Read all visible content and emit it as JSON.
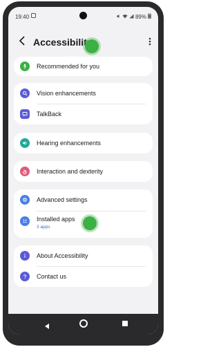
{
  "status": {
    "time": "19:40",
    "battery": "89%"
  },
  "header": {
    "title": "Accessibility"
  },
  "items": {
    "recommended": {
      "label": "Recommended for you"
    },
    "vision": {
      "label": "Vision enhancements"
    },
    "talkback": {
      "label": "TalkBack"
    },
    "hearing": {
      "label": "Hearing enhancements"
    },
    "interaction": {
      "label": "Interaction and dexterity"
    },
    "advanced": {
      "label": "Advanced settings"
    },
    "installed": {
      "label": "Installed apps",
      "sub": "3 apps"
    },
    "about": {
      "label": "About Accessibility"
    },
    "contact": {
      "label": "Contact us"
    }
  },
  "icon_names": {
    "recommended": "person-icon",
    "vision": "magnifier-icon",
    "talkback": "speech-icon",
    "hearing": "speaker-icon",
    "interaction": "hand-icon",
    "advanced": "gear-icon",
    "installed": "dots-icon",
    "about": "info-icon",
    "contact": "question-icon"
  },
  "colors": {
    "recommended": "#3cb043",
    "vision": "#5b5bd6",
    "talkback": "#5b5bd6",
    "hearing": "#1faa9a",
    "interaction": "#e05a7a",
    "advanced": "#4a7ee6",
    "installed": "#4a7ee6",
    "about": "#5b5bd6",
    "contact": "#5b5bd6",
    "marker": "#3cb043"
  }
}
